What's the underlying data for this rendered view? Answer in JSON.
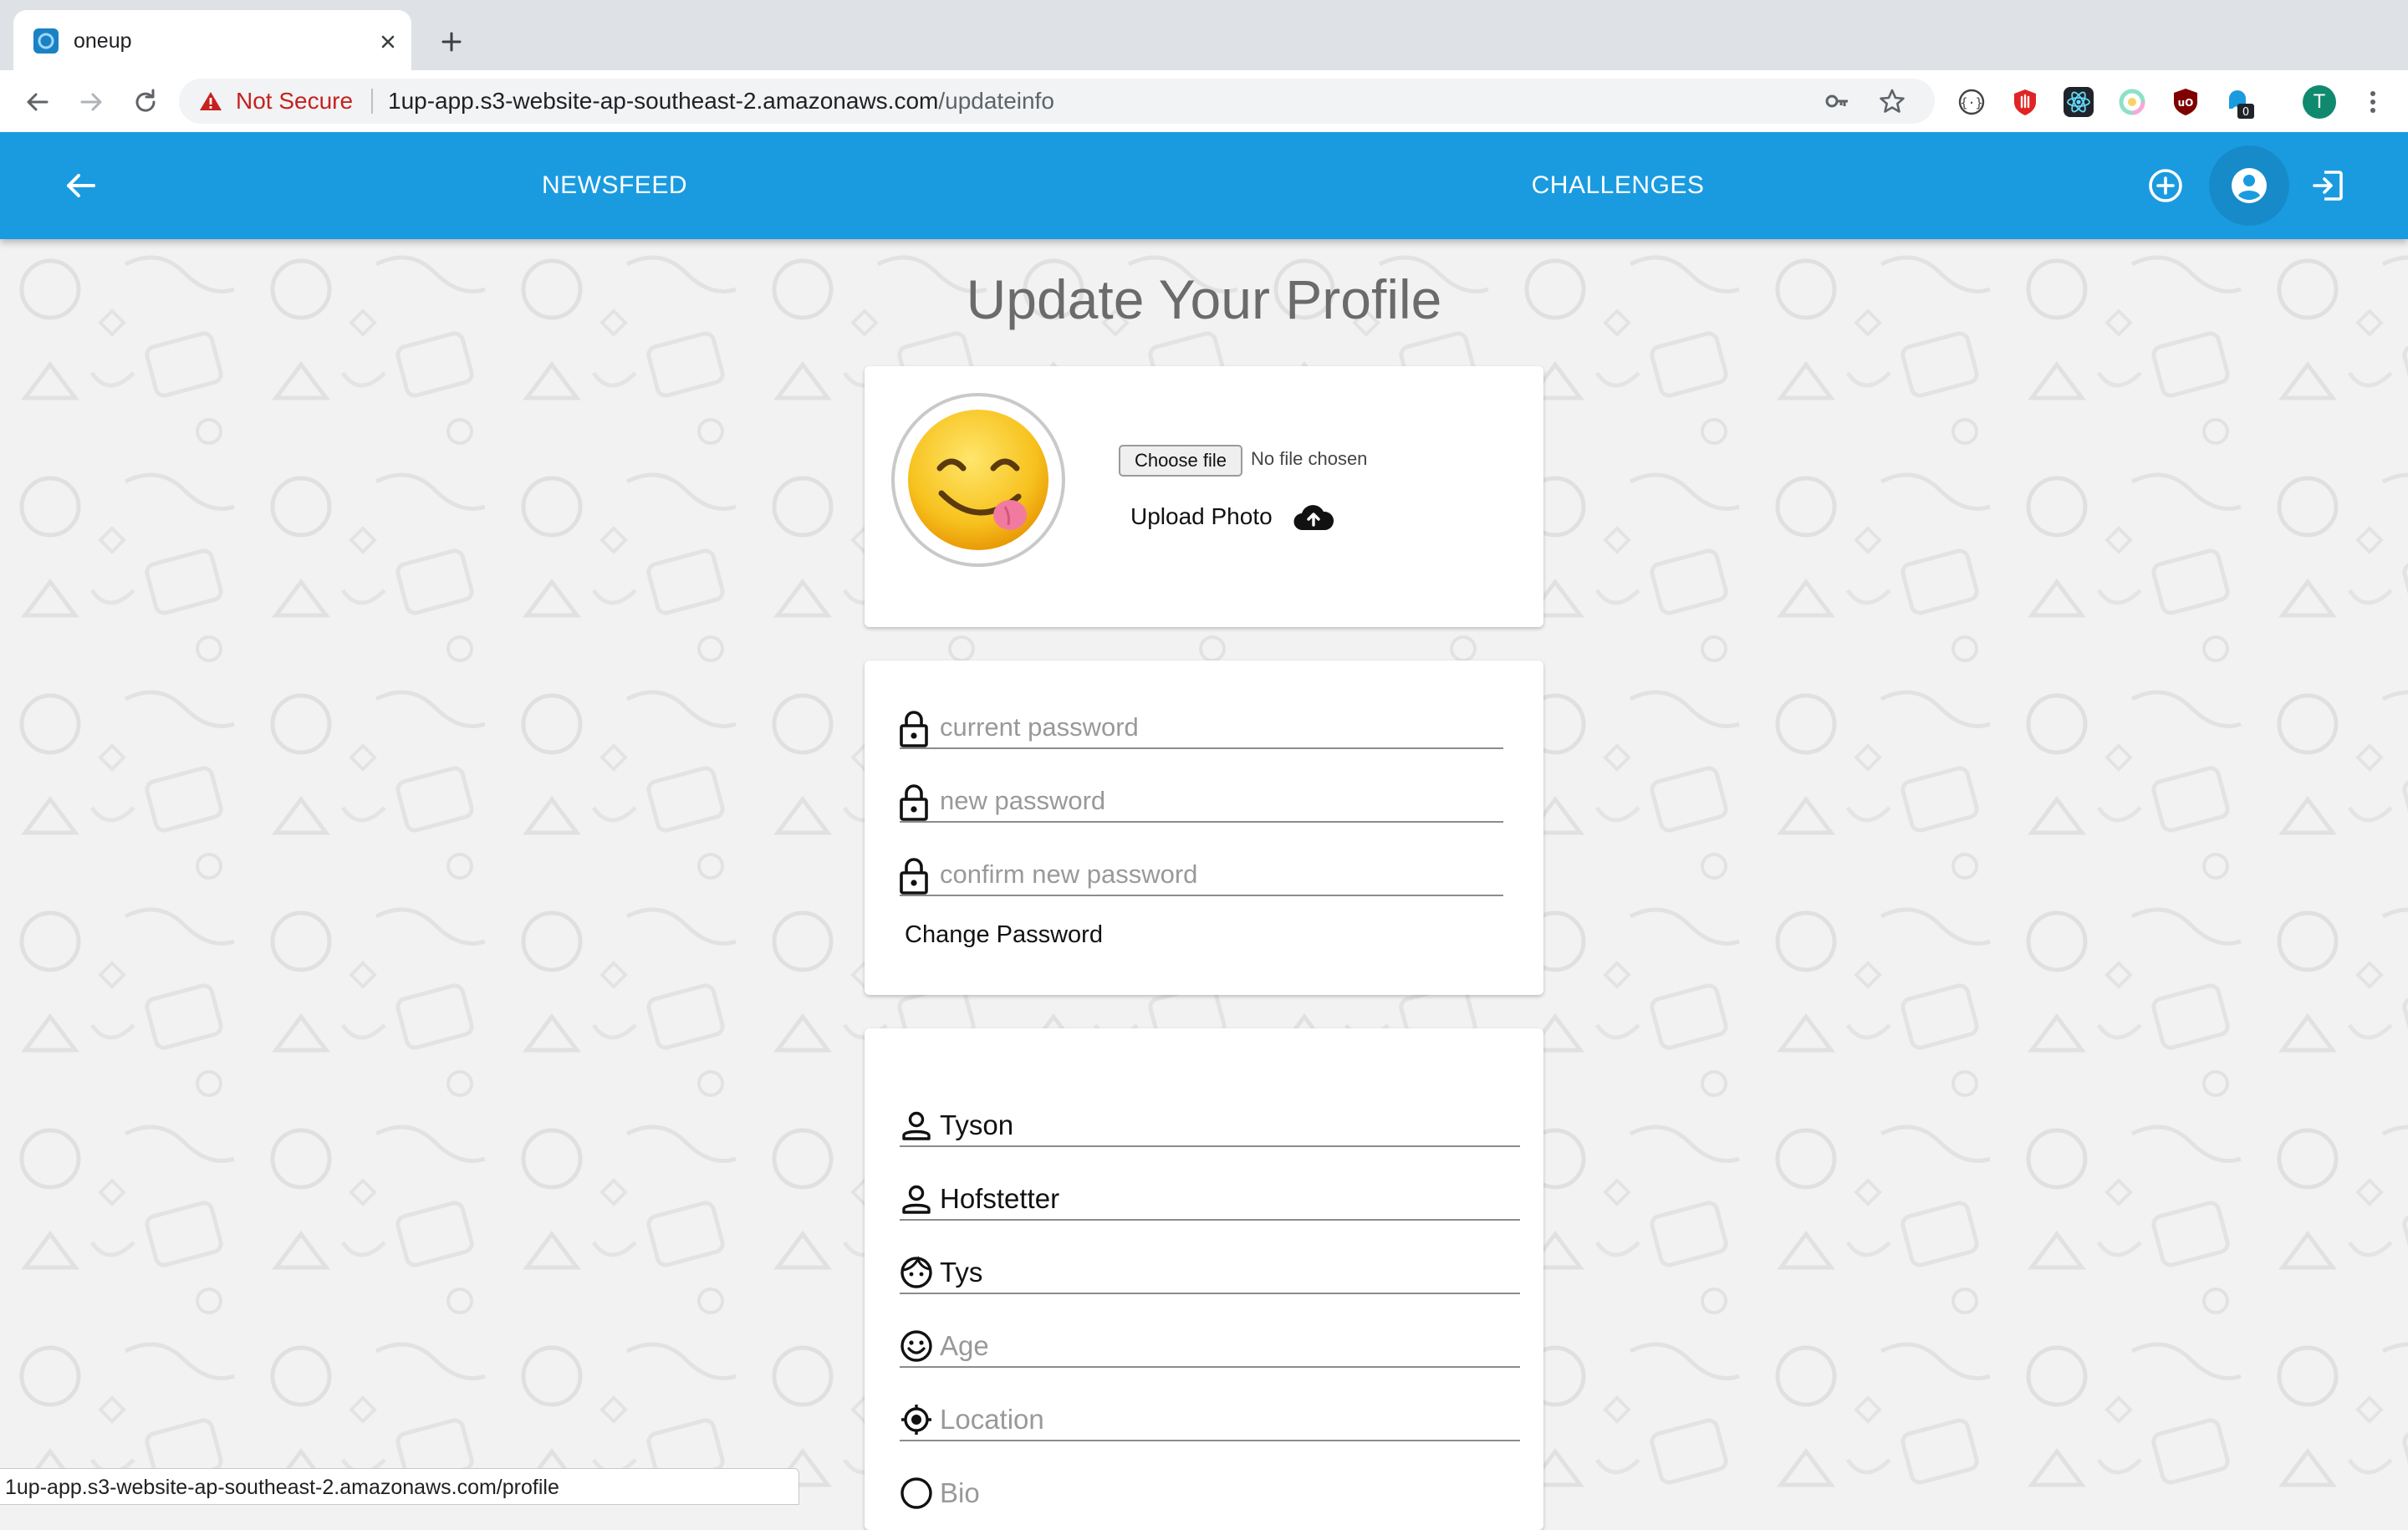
{
  "browser": {
    "tab_title": "oneup",
    "warning": "Not Secure",
    "url_host": "1up-app.s3-website-ap-southeast-2.amazonaws.com",
    "url_path": "/updateinfo",
    "profile_initial": "T",
    "extension_badge": "0",
    "status_url": "1up-app.s3-website-ap-southeast-2.amazonaws.com/profile"
  },
  "nav": {
    "newsfeed": "NEWSFEED",
    "challenges": "CHALLENGES",
    "color": "#1a9be0"
  },
  "page": {
    "title": "Update Your Profile"
  },
  "photo_card": {
    "choose_file": "Choose file",
    "no_file": "No file chosen",
    "upload_label": "Upload Photo"
  },
  "password_card": {
    "current_placeholder": "current password",
    "new_placeholder": "new password",
    "confirm_placeholder": "confirm new password",
    "change_label": "Change Password"
  },
  "info_card": {
    "first_name": "Tyson",
    "last_name": "Hofstetter",
    "username": "Tys",
    "age_placeholder": "Age",
    "location_placeholder": "Location",
    "bio_placeholder": "Bio"
  },
  "icons": [
    "back-arrow-icon",
    "add-circle-icon",
    "account-circle-icon",
    "logout-icon",
    "lock-icon",
    "person-icon",
    "face-icon",
    "smiley-icon",
    "location-icon",
    "cloud-upload-icon"
  ]
}
